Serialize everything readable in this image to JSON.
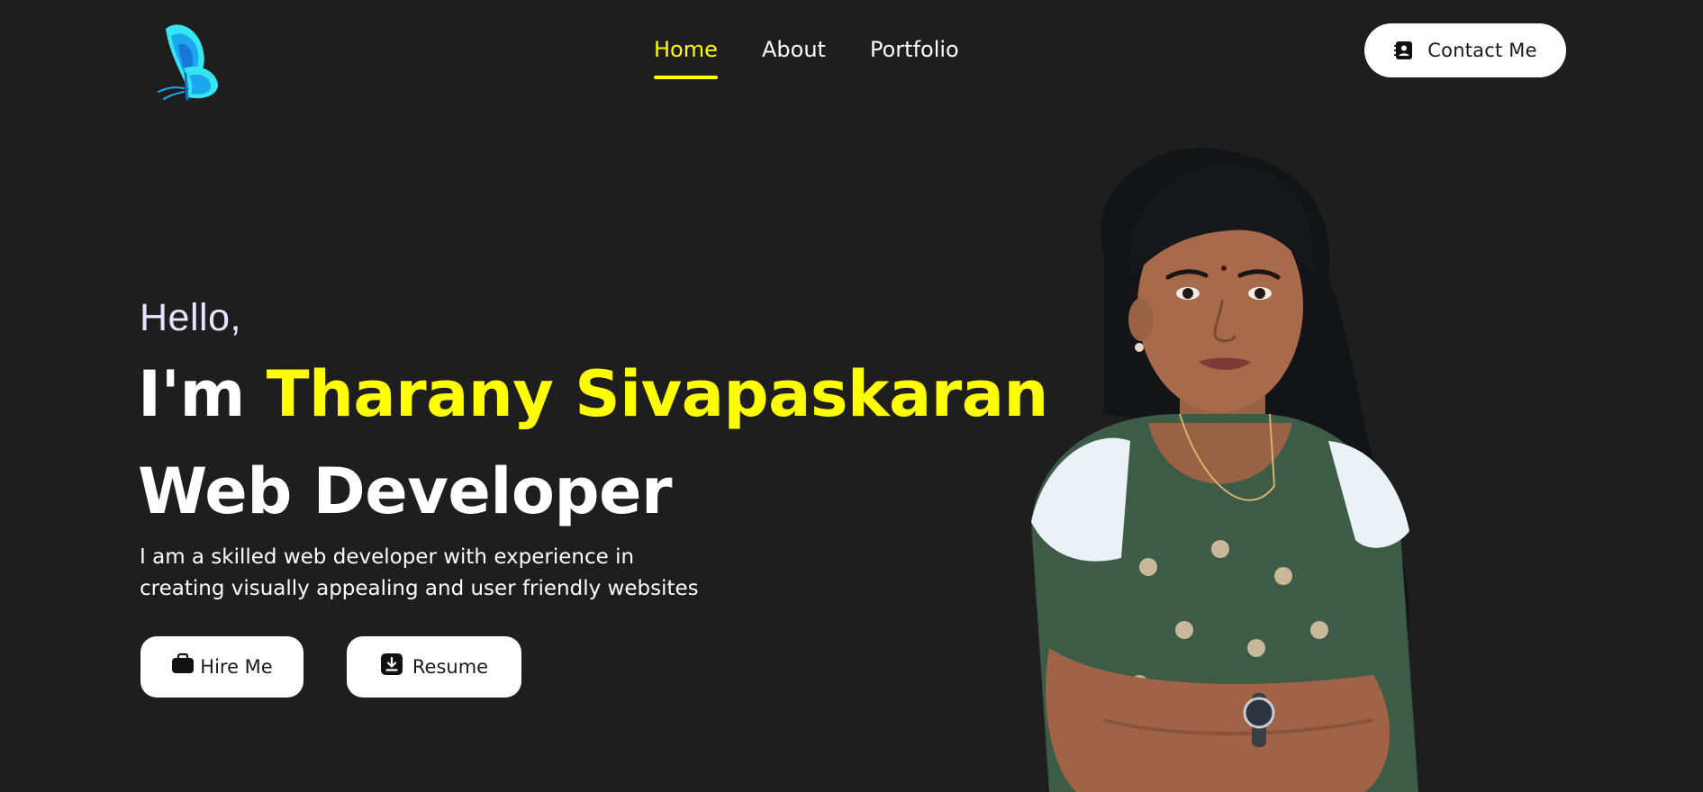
{
  "logo": {
    "icon": "butterfly-logo-icon",
    "colors": [
      "#35e6f2",
      "#1aa7ee",
      "#1778d6"
    ]
  },
  "nav": {
    "items": [
      {
        "label": "Home",
        "active": true
      },
      {
        "label": "About",
        "active": false
      },
      {
        "label": "Portfolio",
        "active": false
      }
    ]
  },
  "header": {
    "contact": {
      "label": "Contact Me",
      "icon": "contact-card-icon"
    }
  },
  "hero": {
    "greeting": "Hello,",
    "prefix": "I'm ",
    "name": "Tharany Sivapaskaran",
    "role": "Web Developer",
    "description_lines": [
      "I am a skilled web developer with experience in",
      "creating visually appealing and user friendly websites"
    ],
    "buttons": {
      "hire": {
        "label": "Hire Me",
        "icon": "briefcase-icon"
      },
      "resume": {
        "label": "Resume",
        "icon": "download-icon"
      }
    },
    "portrait": {
      "icon": "profile-photo"
    }
  },
  "colors": {
    "background": "#1e1e1e",
    "accent": "#ffff00",
    "text": "#ffffff",
    "button_bg": "#ffffff",
    "button_text": "#1a1a1a"
  }
}
